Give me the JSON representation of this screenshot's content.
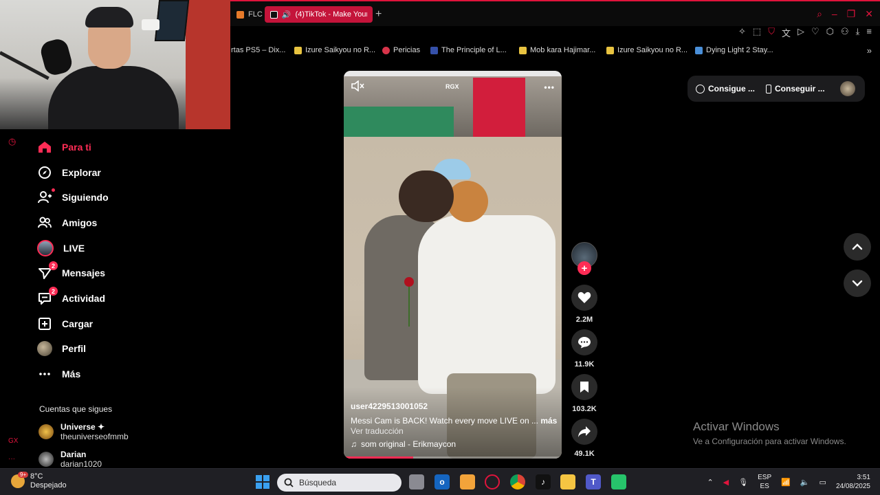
{
  "browser": {
    "tabs": [
      {
        "label": "FLC",
        "active": false
      },
      {
        "label": "(4)TikTok - Make Your",
        "active": true
      }
    ],
    "new_tab": "+",
    "bookmarks": [
      "rtas PS5 – Dix...",
      "Izure Saikyou no R...",
      "Pericias",
      "The Principle of L...",
      "Mob kara Hajimar...",
      "Izure Saikyou no R...",
      "Dying Light 2 Stay..."
    ],
    "bookmarks_more": "»"
  },
  "sidebar": {
    "items": [
      {
        "label": "Para ti",
        "icon": "home-icon",
        "active": true,
        "badge": ""
      },
      {
        "label": "Explorar",
        "icon": "compass-icon",
        "active": false,
        "badge": ""
      },
      {
        "label": "Siguiendo",
        "icon": "person-follow-icon",
        "active": false,
        "badge": ""
      },
      {
        "label": "Amigos",
        "icon": "friends-icon",
        "active": false,
        "badge": ""
      },
      {
        "label": "LIVE",
        "icon": "live-avatar-icon",
        "active": false,
        "badge": ""
      },
      {
        "label": "Mensajes",
        "icon": "paper-plane-icon",
        "active": false,
        "badge": "2"
      },
      {
        "label": "Actividad",
        "icon": "chat-bubble-icon",
        "active": false,
        "badge": "2"
      },
      {
        "label": "Cargar",
        "icon": "plus-square-icon",
        "active": false,
        "badge": ""
      },
      {
        "label": "Perfil",
        "icon": "profile-avatar-icon",
        "active": false,
        "badge": ""
      },
      {
        "label": "Más",
        "icon": "more-dots-icon",
        "active": false,
        "badge": ""
      }
    ],
    "following_title": "Cuentas que sigues",
    "following": [
      {
        "name": "Universe ✦",
        "handle": "theuniverseofmmb"
      },
      {
        "name": "Darian",
        "handle": "darian1020"
      }
    ],
    "rail_gx": "GX",
    "rail_more": "···"
  },
  "video": {
    "watermark": "RGX",
    "username": "user4229513001052",
    "caption": "Messi Cam is BACK! Watch every move LIVE on ...",
    "more": "más",
    "translate": "Ver traducción",
    "sound": "som original - Erikmaycon",
    "progress": 0.32
  },
  "actions": {
    "likes": "2.2M",
    "comments": "11.9K",
    "saves": "103.2K",
    "shares": "49.1K"
  },
  "promo": {
    "item1": "Consigue ...",
    "item2": "Conseguir ..."
  },
  "watermark": {
    "line1": "Activar Windows",
    "line2": "Ve a Configuración para activar Windows."
  },
  "taskbar": {
    "weather_badge": "9+",
    "temp": "8°C",
    "condition": "Despejado",
    "search_placeholder": "Búsqueda",
    "lang1": "ESP",
    "lang2": "ES",
    "time": "3:51",
    "date": "24/08/2025"
  },
  "colors": {
    "accent": "#fe2c55",
    "browser_accent": "#e0143c"
  }
}
